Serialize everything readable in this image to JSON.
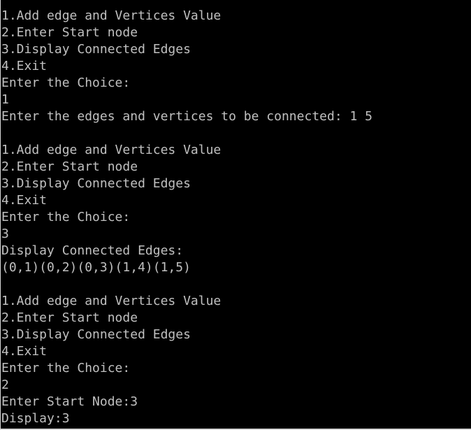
{
  "console": {
    "lines": [
      "1.Add edge and Vertices Value",
      "2.Enter Start node",
      "3.Display Connected Edges",
      "4.Exit",
      "Enter the Choice:",
      "1",
      "Enter the edges and vertices to be connected: 1 5",
      "",
      "1.Add edge and Vertices Value",
      "2.Enter Start node",
      "3.Display Connected Edges",
      "4.Exit",
      "Enter the Choice:",
      "3",
      "Display Connected Edges:",
      "(0,1)(0,2)(0,3)(1,4)(1,5)",
      "",
      "1.Add edge and Vertices Value",
      "2.Enter Start node",
      "3.Display Connected Edges",
      "4.Exit",
      "Enter the Choice:",
      "2",
      "Enter Start Node:3",
      "Display:3"
    ]
  },
  "colors": {
    "background": "#000000",
    "text": "#c0c0c0"
  }
}
